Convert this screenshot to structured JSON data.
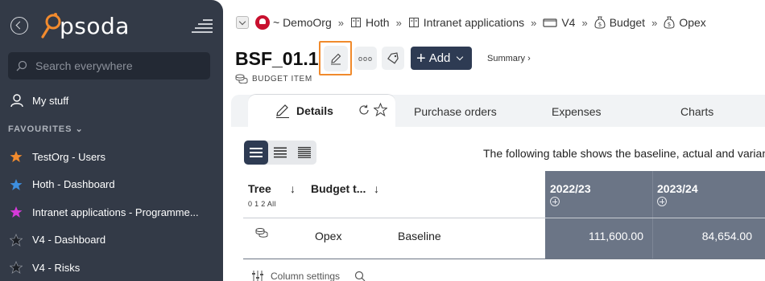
{
  "sidebar": {
    "logo_text": "psoda",
    "search_placeholder": "Search everywhere",
    "my_stuff": "My stuff",
    "favourites_heading": "FAVOURITES",
    "favourites": [
      {
        "label": "TestOrg - Users",
        "color": "#f28b2e"
      },
      {
        "label": "Hoth - Dashboard",
        "color": "#3d8fe0"
      },
      {
        "label": "Intranet applications - Programme...",
        "color": "#d63ad9"
      },
      {
        "label": "V4 - Dashboard",
        "color": "#1c1f25"
      },
      {
        "label": "V4 - Risks",
        "color": "#1c1f25"
      }
    ]
  },
  "breadcrumb": [
    {
      "label": "~ DemoOrg",
      "icon": "org-logo-icon"
    },
    {
      "label": "Hoth",
      "icon": "book-icon"
    },
    {
      "label": "Intranet applications",
      "icon": "book-icon"
    },
    {
      "label": "V4",
      "icon": "folder-icon"
    },
    {
      "label": "Budget",
      "icon": "money-bag-icon"
    },
    {
      "label": "Opex",
      "icon": "money-bag-icon"
    }
  ],
  "header": {
    "title": "BSF_01.1",
    "item_type": "BUDGET ITEM",
    "add_label": "Add",
    "summary_label": "Summary ›"
  },
  "tabs": {
    "details": "Details",
    "purchase_orders": "Purchase orders",
    "expenses": "Expenses",
    "charts": "Charts"
  },
  "content": {
    "description": "The following table shows the baseline, actual and variance"
  },
  "table": {
    "col_tree": "Tree",
    "tree_levels": "0 1 2 All",
    "col_budget_type": "Budget t...",
    "years": [
      "2022/23",
      "2023/24"
    ],
    "row": {
      "name": "Opex",
      "type": "Baseline",
      "values": [
        "111,600.00",
        "84,654.00"
      ]
    }
  },
  "footer": {
    "column_settings": "Column settings"
  },
  "colors": {
    "sidebar_bg": "#333a47",
    "accent_orange": "#f08a2c",
    "add_button": "#2e3b53",
    "year_column": "#6b7586"
  }
}
